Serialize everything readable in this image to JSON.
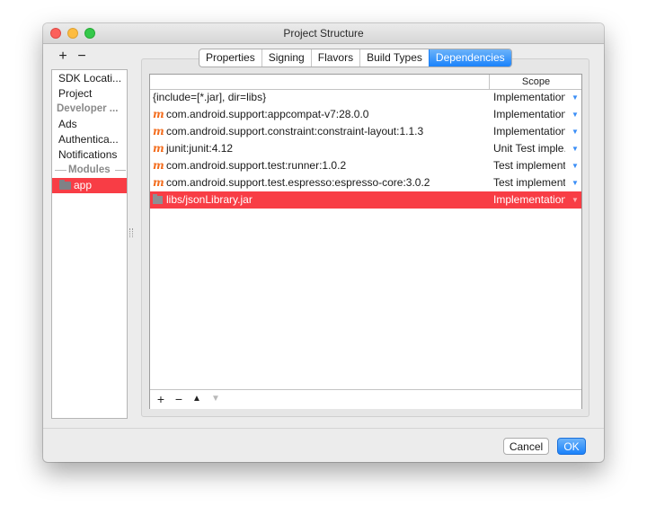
{
  "window": {
    "title": "Project Structure"
  },
  "left_panel": {
    "add_label": "+",
    "remove_label": "−",
    "items": [
      "SDK Locati...",
      "Project"
    ],
    "developer_section": "Developer ...",
    "developer_items": [
      "Ads",
      "Authentica...",
      "Notifications"
    ],
    "modules_section": "Modules",
    "selected_module": "app"
  },
  "tabs": [
    "Properties",
    "Signing",
    "Flavors",
    "Build Types",
    "Dependencies"
  ],
  "active_tab": "Dependencies",
  "table": {
    "scope_header": "Scope",
    "rows": [
      {
        "icon": "none",
        "name": "{include=[*.jar], dir=libs}",
        "scope": "Implementation"
      },
      {
        "icon": "maven-icon",
        "name": "com.android.support:appcompat-v7:28.0.0",
        "scope": "Implementation"
      },
      {
        "icon": "maven-icon",
        "name": "com.android.support.constraint:constraint-layout:1.1.3",
        "scope": "Implementation"
      },
      {
        "icon": "maven-icon",
        "name": "junit:junit:4.12",
        "scope": "Unit Test imple..."
      },
      {
        "icon": "maven-icon",
        "name": "com.android.support.test:runner:1.0.2",
        "scope": "Test implement..."
      },
      {
        "icon": "maven-icon",
        "name": "com.android.support.test.espresso:espresso-core:3.0.2",
        "scope": "Test implement..."
      },
      {
        "icon": "jar-icon",
        "name": "libs/jsonLibrary.jar",
        "scope": "Implementation",
        "selected": true
      }
    ],
    "maven_glyph": "m",
    "toolbar": {
      "add": "+",
      "remove": "−",
      "up": "▲",
      "down": "▼"
    }
  },
  "buttons": {
    "cancel": "Cancel",
    "ok": "OK"
  },
  "colors": {
    "selection": "#f83d45",
    "accent_blue": "#1a82fb",
    "maven_orange": "#f36d1e"
  }
}
